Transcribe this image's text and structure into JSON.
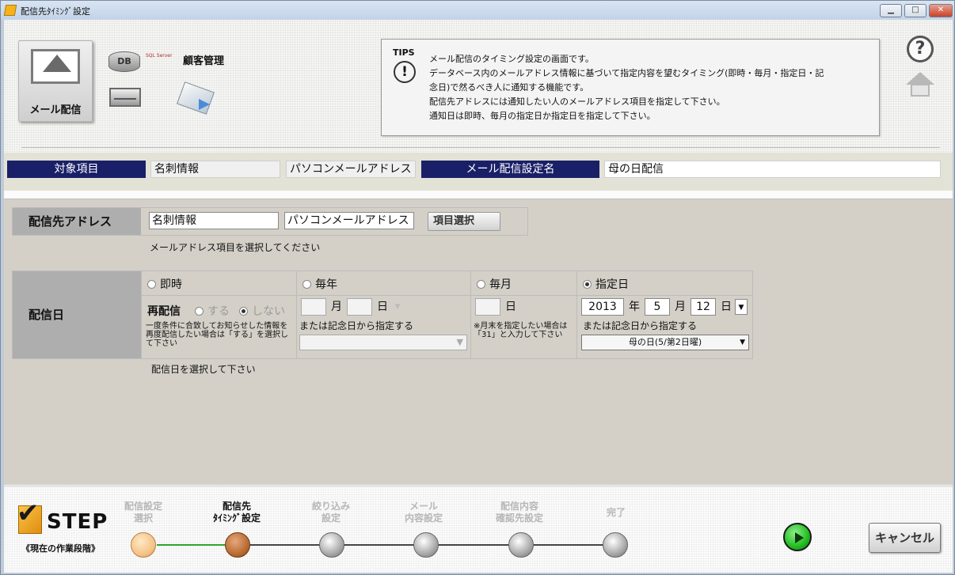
{
  "window": {
    "title": "配信先ﾀｲﾐﾝｸﾞ設定",
    "min_label": "▁",
    "max_label": "□",
    "close_label": "✕"
  },
  "toolbar": {
    "mail_button_label": "メール配信",
    "db_label": "DB",
    "sqlserver_label": "SQL Server",
    "customer_label": "顧客管理"
  },
  "tips": {
    "title": "TIPS",
    "icon": "!",
    "lines": [
      "メール配信のタイミング設定の画面です。",
      "データベース内のメールアドレス情報に基づいて指定内容を望むタイミング(即時・毎月・指定日・記",
      "念日)で然るべき人に通知する機能です。",
      "配信先アドレスには通知したい人のメールアドレス項目を指定して下さい。",
      "通知日は即時、毎月の指定日か指定日を指定して下さい。"
    ]
  },
  "help_icon": "?",
  "info": {
    "target_header": "対象項目",
    "target_table": "名刺情報",
    "target_field": "パソコンメールアドレス",
    "mail_name_header": "メール配信設定名",
    "mail_name_value": "母の日配信"
  },
  "address": {
    "label": "配信先アドレス",
    "table_value": "名刺情報",
    "field_value": "パソコンメールアドレス",
    "select_button": "項目選択",
    "hint": "メールアドレス項目を選択してください"
  },
  "schedule": {
    "label": "配信日",
    "options": {
      "immediate": "即時",
      "yearly": "毎年",
      "monthly": "毎月",
      "specified": "指定日"
    },
    "selected": "specified",
    "resend_label": "再配信",
    "resend_yes": "する",
    "resend_no": "しない",
    "resend_note": "一度条件に合致してお知らせした情報を再度配信したい場合は「する」を選択して下さい",
    "yearly_month_unit": "月",
    "yearly_day_unit": "日",
    "yearly_anniv_text": "または記念日から指定する",
    "monthly_day_unit": "日",
    "monthly_note": "※月末を指定したい場合は「31」と入力して下さい",
    "specified_year": "2013",
    "year_unit": "年",
    "specified_month": "5",
    "month_unit": "月",
    "specified_day": "12",
    "day_unit": "日",
    "specified_anniv_text": "または記念日から指定する",
    "specified_anniv_value": "母の日(5/第2日曜)",
    "hint": "配信日を選択して下さい"
  },
  "steps": {
    "logo_text": "STEP",
    "caption": "《現在の作業段階》",
    "items": [
      {
        "line1": "配信設定",
        "line2": "選択"
      },
      {
        "line1": "配信先",
        "line2": "ﾀｲﾐﾝｸﾞ設定"
      },
      {
        "line1": "絞り込み",
        "line2": "設定"
      },
      {
        "line1": "メール",
        "line2": "内容設定"
      },
      {
        "line1": "配信内容",
        "line2": "確認先設定"
      },
      {
        "line1": "完了",
        "line2": ""
      }
    ],
    "current_index": 1
  },
  "cancel_label": "キャンセル",
  "colors": {
    "header_bg": "#1a2067",
    "play_green": "#22bd22"
  }
}
